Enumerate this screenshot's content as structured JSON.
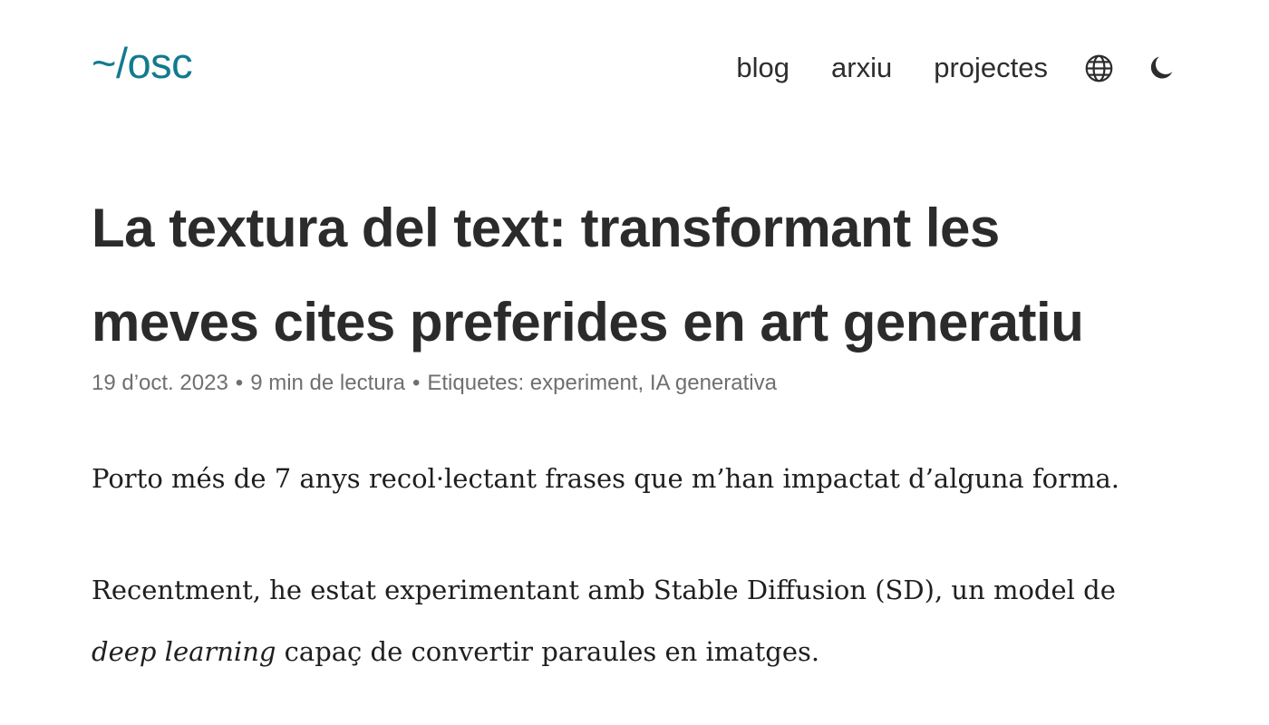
{
  "header": {
    "logo": "~/osc",
    "nav": [
      {
        "label": "blog"
      },
      {
        "label": "arxiu"
      },
      {
        "label": "projectes"
      }
    ],
    "icons": {
      "language": "globe-icon",
      "theme": "moon-icon"
    }
  },
  "article": {
    "title": "La textura del text: transformant les meves cites preferides en art generatiu",
    "meta": {
      "date": "19 d’oct. 2023",
      "separator": "•",
      "reading_time": "9 min de lectura",
      "tags_label": "Etiquetes:",
      "tags": [
        "experiment",
        "IA generativa"
      ],
      "tag_separator": ","
    },
    "paragraph1": "Porto més de 7 anys recol·lectant frases que m’han impactat d’alguna forma.",
    "paragraph2": {
      "part1": "Recentment, he estat experimentant amb Stable Diffusion (SD), un model de ",
      "italic": "deep learning",
      "part2": " capaç de convertir paraules en imatges."
    }
  },
  "colors": {
    "accent": "#127a8f",
    "text": "#2b2b2b",
    "muted": "#6f6f6f"
  }
}
